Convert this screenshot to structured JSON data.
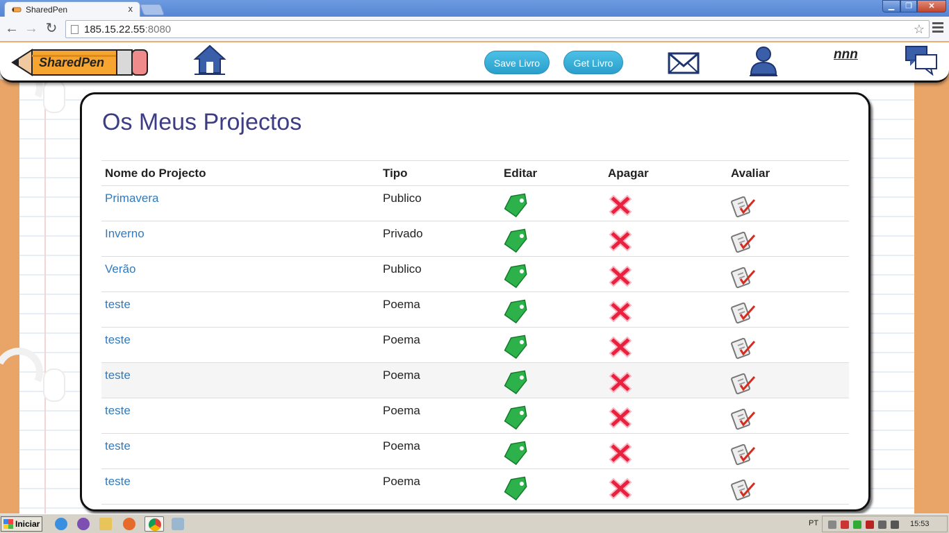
{
  "browser": {
    "tab_title": "SharedPen",
    "tab_close": "x",
    "url_host": "185.15.22.55",
    "url_port": ":8080",
    "window_minimize": "▁",
    "window_maximize": "❐",
    "window_close": "✕"
  },
  "header": {
    "logo_text": "SharedPen",
    "save_button": "Save Livro",
    "get_button": "Get Livro",
    "username": "nnn"
  },
  "main": {
    "title": "Os Meus Projectos",
    "columns": [
      "Nome do Projecto",
      "Tipo",
      "Editar",
      "Apagar",
      "Avaliar"
    ],
    "rows": [
      {
        "name": "Primavera",
        "type": "Publico"
      },
      {
        "name": "Inverno",
        "type": "Privado"
      },
      {
        "name": "Verão",
        "type": "Publico"
      },
      {
        "name": "teste",
        "type": "Poema"
      },
      {
        "name": "teste",
        "type": "Poema"
      },
      {
        "name": "teste",
        "type": "Poema"
      },
      {
        "name": "teste",
        "type": "Poema"
      },
      {
        "name": "teste",
        "type": "Poema"
      },
      {
        "name": "teste",
        "type": "Poema"
      }
    ],
    "icons": {
      "edit": "edit-tag-icon",
      "delete": "delete-x-icon",
      "rate": "rate-checklist-icon"
    },
    "colors": {
      "title": "#3d3d86",
      "link": "#2f7bbf",
      "pill": "#2aa4d0",
      "edit": "#2db14a",
      "delete": "#e8213e"
    }
  },
  "taskbar": {
    "start_label": "Iniciar",
    "language": "PT",
    "clock": "15:53"
  }
}
